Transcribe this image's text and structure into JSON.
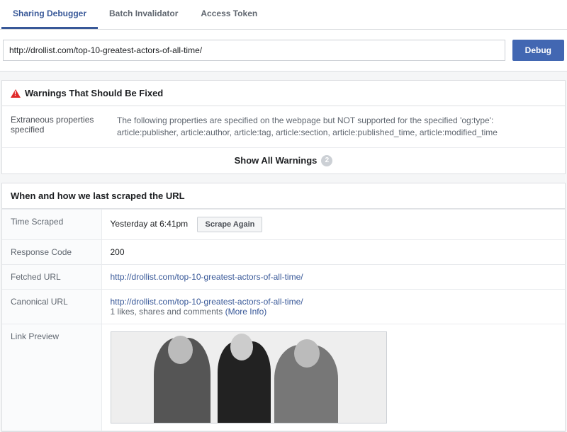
{
  "tabs": {
    "sharing_debugger": "Sharing Debugger",
    "batch_invalidator": "Batch Invalidator",
    "access_token": "Access Token"
  },
  "url_input": "http://drollist.com/top-10-greatest-actors-of-all-time/",
  "debug_btn": "Debug",
  "warnings": {
    "header": "Warnings That Should Be Fixed",
    "row_label": "Extraneous properties specified",
    "row_text": "The following properties are specified on the webpage but NOT supported for the specified 'og:type': article:publisher, article:author, article:tag, article:section, article:published_time, article:modified_time",
    "show_all": "Show All Warnings",
    "count": "2"
  },
  "scrape": {
    "header": "When and how we last scraped the URL",
    "rows": {
      "time_scraped_label": "Time Scraped",
      "time_scraped_value": "Yesterday at 6:41pm",
      "scrape_again_btn": "Scrape Again",
      "response_code_label": "Response Code",
      "response_code_value": "200",
      "fetched_url_label": "Fetched URL",
      "fetched_url_value": "http://drollist.com/top-10-greatest-actors-of-all-time/",
      "canonical_url_label": "Canonical URL",
      "canonical_url_value": "http://drollist.com/top-10-greatest-actors-of-all-time/",
      "canonical_meta": "1 likes, shares and comments",
      "more_info": "(More Info)",
      "link_preview_label": "Link Preview"
    }
  }
}
